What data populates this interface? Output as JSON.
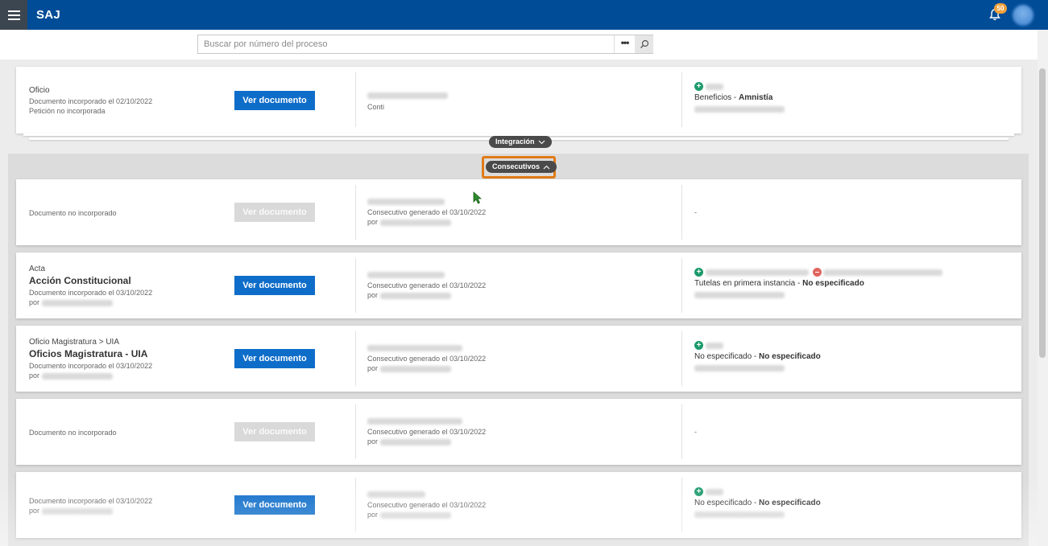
{
  "header": {
    "title": "SAJ",
    "notification_count": "50",
    "accent_color": "#004c97"
  },
  "search": {
    "placeholder": "Buscar por número del proceso",
    "more_label": "•••"
  },
  "toggles": {
    "integracion": "Integración",
    "consecutivos": "Consecutivos"
  },
  "top_card": {
    "type": "Oficio",
    "meta1": "Documento incorporado el 02/10/2022",
    "meta2": "Petición no incorporada",
    "button": "Ver documento",
    "col2_text": "Conti",
    "col3_prefix": "Beneficios - ",
    "col3_bold": "Amnistía"
  },
  "cards": [
    {
      "meta1": "Documento no incorporado",
      "button": "Ver documento",
      "consecutivo": "Consecutivo generado el 03/10/2022",
      "por": "por",
      "dash": "-"
    },
    {
      "type": "Acta",
      "title": "Acción Constitucional",
      "meta1": "Documento incorporado el 03/10/2022",
      "por": "por",
      "button": "Ver documento",
      "consecutivo": "Consecutivo generado el 03/10/2022",
      "col3_prefix": "Tutelas en primera instancia - ",
      "col3_bold": "No especificado"
    },
    {
      "type": "Oficio Magistratura > UIA",
      "title": "Oficios Magistratura - UIA",
      "meta1": "Documento incorporado el 03/10/2022",
      "por": "por",
      "button": "Ver documento",
      "consecutivo": "Consecutivo generado el 03/10/2022",
      "col3_prefix": "No especificado - ",
      "col3_bold": "No especificado"
    },
    {
      "meta1": "Documento no incorporado",
      "button": "Ver documento",
      "consecutivo": "Consecutivo generado el 03/10/2022",
      "por": "por",
      "dash": "-"
    },
    {
      "meta1": "Documento incorporado el 03/10/2022",
      "por": "por",
      "button": "Ver documento",
      "consecutivo": "Consecutivo generado el 03/10/2022",
      "col3_prefix": "No especificado - ",
      "col3_bold": "No especificado"
    }
  ]
}
